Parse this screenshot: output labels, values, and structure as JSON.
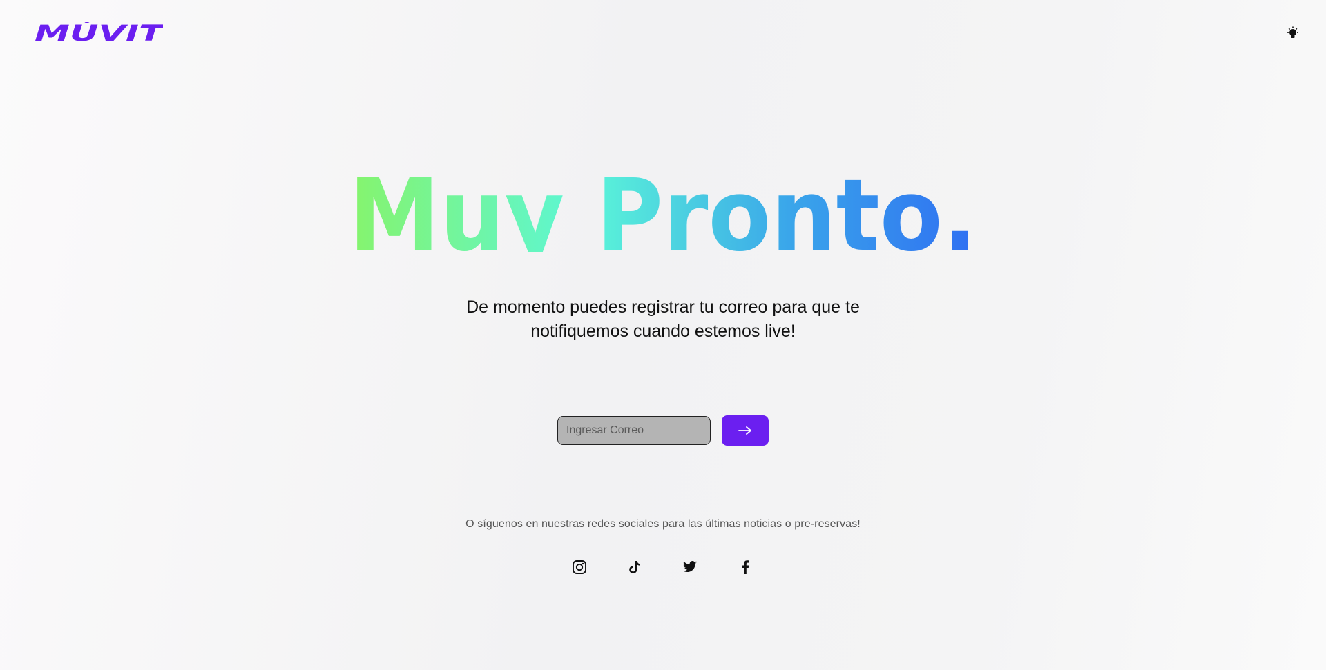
{
  "header": {
    "brand": "MÚVIT",
    "brand_color": "#6b1ff0",
    "theme_toggle_icon": "lightbulb-icon"
  },
  "hero": {
    "title": "Muy Pronto.",
    "gradient_colors": [
      "#86f46c",
      "#5bf6d8",
      "#3aa6ea",
      "#2f6ff2"
    ],
    "subtitle_line1": "De momento puedes registrar tu correo para que te",
    "subtitle_line2": "notifiquemos cuando estemos live!"
  },
  "signup": {
    "email_placeholder": "Ingresar Correo",
    "email_value": "",
    "submit_icon": "arrow-right-icon",
    "accent_color": "#6b1ff0"
  },
  "social": {
    "text": "O síguenos en nuestras redes sociales para las últimas noticias o pre-reservas!",
    "links": [
      {
        "name": "instagram",
        "icon": "instagram-icon"
      },
      {
        "name": "tiktok",
        "icon": "tiktok-icon"
      },
      {
        "name": "twitter",
        "icon": "twitter-icon"
      },
      {
        "name": "facebook",
        "icon": "facebook-icon"
      }
    ]
  }
}
